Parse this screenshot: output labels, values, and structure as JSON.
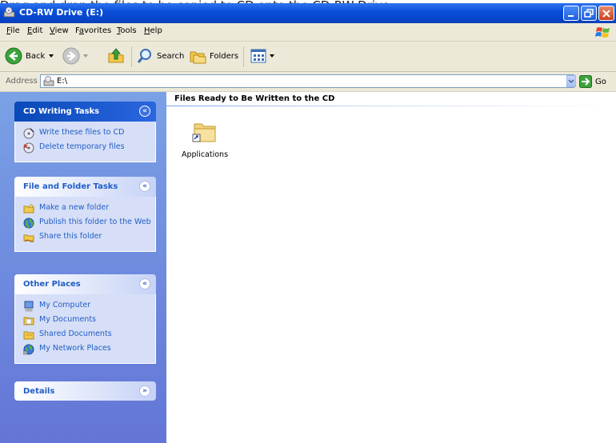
{
  "caption": "Drag and drop the files to be copied to CD onto the CD-RW Drive",
  "window": {
    "title": "CD-RW Drive (E:)"
  },
  "menu": {
    "items": [
      {
        "label": "File",
        "u": "F",
        "rest": "ile"
      },
      {
        "label": "Edit",
        "u": "E",
        "rest": "dit"
      },
      {
        "label": "View",
        "u": "V",
        "rest": "iew"
      },
      {
        "label": "Favorites",
        "u": "a",
        "pre": "F",
        "rest": "vorites"
      },
      {
        "label": "Tools",
        "u": "T",
        "rest": "ools"
      },
      {
        "label": "Help",
        "u": "H",
        "rest": "elp"
      }
    ]
  },
  "toolbar": {
    "back_label": "Back",
    "search_label": "Search",
    "folders_label": "Folders"
  },
  "address": {
    "label": "Address",
    "value": "E:\\",
    "go_label": "Go"
  },
  "panels": {
    "cd_writing": {
      "title": "CD Writing Tasks",
      "tasks": [
        "Write these files to CD",
        "Delete temporary files"
      ]
    },
    "file_folder": {
      "title": "File and Folder Tasks",
      "tasks": [
        "Make a new folder",
        "Publish this folder to the Web",
        "Share this folder"
      ]
    },
    "other_places": {
      "title": "Other Places",
      "places": [
        "My Computer",
        "My Documents",
        "Shared Documents",
        "My Network Places"
      ]
    },
    "details": {
      "title": "Details"
    }
  },
  "content": {
    "header": "Files Ready to Be Written to the CD",
    "files": [
      {
        "name": "Applications",
        "icon": "folder-icon"
      }
    ]
  },
  "colors": {
    "title_bar": "#0a4fd8",
    "task_link": "#215dc6",
    "task_pane": "#7aa1e6"
  }
}
